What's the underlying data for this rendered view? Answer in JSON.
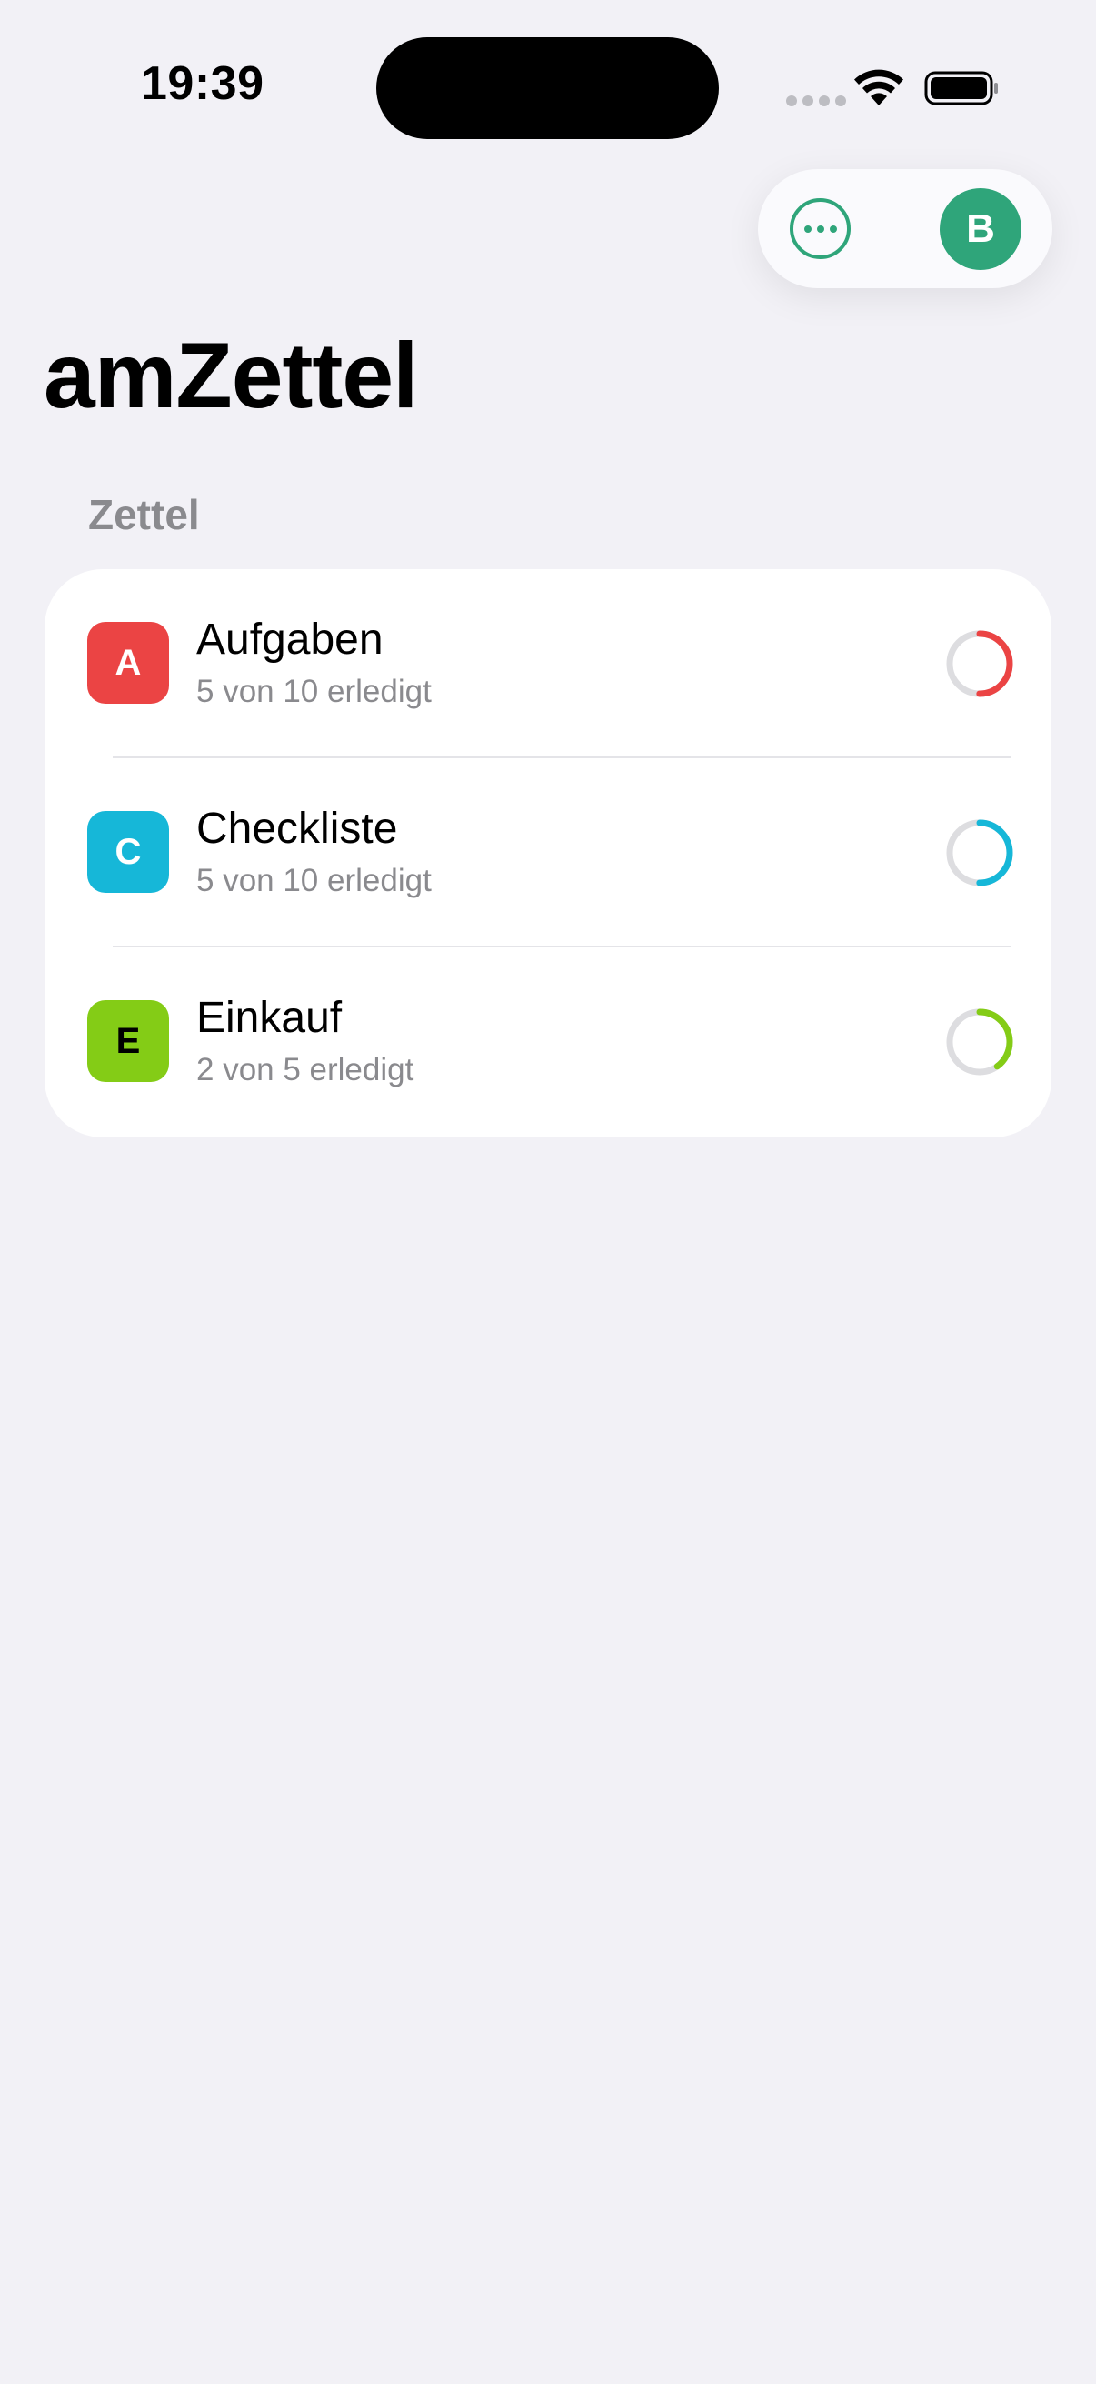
{
  "status_bar": {
    "time": "19:39"
  },
  "header": {
    "more_icon": "ellipsis-circle-icon",
    "avatar_initial": "B",
    "accent_color": "#2FA57A"
  },
  "title": "amZettel",
  "section": {
    "header": "Zettel"
  },
  "lists": [
    {
      "initial": "A",
      "title": "Aufgaben",
      "subtitle": "5 von 10 erledigt",
      "badge_color": "#EB4444",
      "badge_text_color": "#FFFFFF",
      "progress": 0.5
    },
    {
      "initial": "C",
      "title": "Checkliste",
      "subtitle": "5 von 10 erledigt",
      "badge_color": "#16B7D8",
      "badge_text_color": "#FFFFFF",
      "progress": 0.5
    },
    {
      "initial": "E",
      "title": "Einkauf",
      "subtitle": "2 von 5 erledigt",
      "badge_color": "#84CC16",
      "badge_text_color": "#000000",
      "progress": 0.4
    }
  ]
}
